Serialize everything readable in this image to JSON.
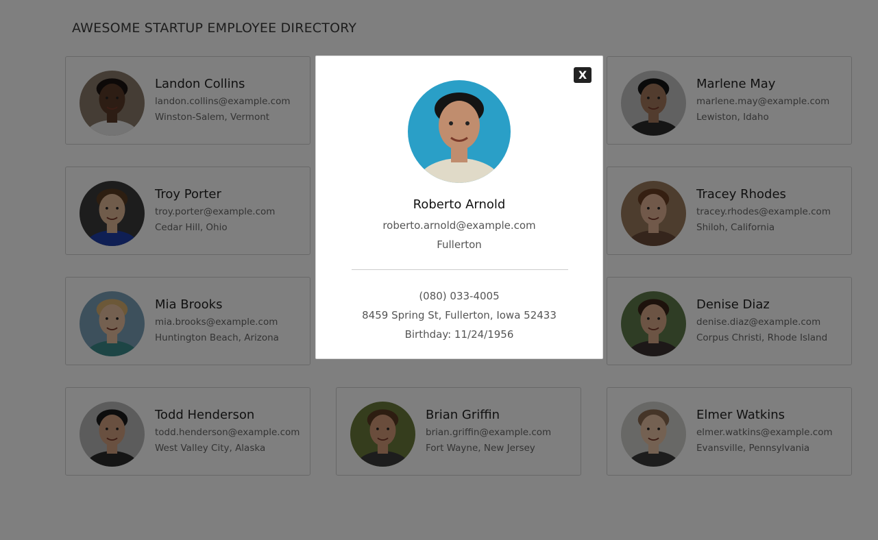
{
  "header": {
    "title": "AWESOME STARTUP EMPLOYEE DIRECTORY"
  },
  "employees": [
    {
      "name": "Landon Collins",
      "email": "landon.collins@example.com",
      "location": "Winston-Salem, Vermont",
      "skin": "#5a3a28",
      "bg": "#8a7a6a",
      "hair": "#1b1310",
      "shirt": "#e8e8e8"
    },
    {
      "name": "Roberto Arnold",
      "email": "roberto.arnold@example.com",
      "location": "Fullerton, Iowa",
      "skin": "#c08d6e",
      "bg": "#2a9fc7",
      "hair": "#141414",
      "shirt": "#e0dac8"
    },
    {
      "name": "Marlene May",
      "email": "marlene.may@example.com",
      "location": "Lewiston, Idaho",
      "skin": "#a4785c",
      "bg": "#c2c2c2",
      "hair": "#151515",
      "shirt": "#2b2b2b"
    },
    {
      "name": "Troy Porter",
      "email": "troy.porter@example.com",
      "location": "Cedar Hill, Ohio",
      "skin": "#e0b896",
      "bg": "#3a3a3a",
      "hair": "#5b3c22",
      "shirt": "#1f3fa8"
    },
    {
      "name": "Tracey Rhodes",
      "email": "tracey.rhodes@example.com",
      "location": "Shiloh, California",
      "skin": "#e2b295",
      "bg": "#9a7a5c",
      "hair": "#6a3e22",
      "shirt": "#6b4a38"
    },
    {
      "name": "Mia Brooks",
      "email": "mia.brooks@example.com",
      "location": "Huntington Beach, Arizona",
      "skin": "#e8c0a0",
      "bg": "#7ba0b8",
      "hair": "#d9b070",
      "shirt": "#3a8a8a"
    },
    {
      "name": "Denise Diaz",
      "email": "denise.diaz@example.com",
      "location": "Corpus Christi, Rhode Island",
      "skin": "#d8a888",
      "bg": "#5f7a4a",
      "hair": "#3a2418",
      "shirt": "#3a3030"
    },
    {
      "name": "Todd Henderson",
      "email": "todd.henderson@example.com",
      "location": "West Valley City, Alaska",
      "skin": "#d2a080",
      "bg": "#b8b8b8",
      "hair": "#1a1a1a",
      "shirt": "#2a2a2a"
    },
    {
      "name": "Brian Griffin",
      "email": "brian.griffin@example.com",
      "location": "Fort Wayne, New Jersey",
      "skin": "#d49a78",
      "bg": "#6a7a3a",
      "hair": "#5a3a22",
      "shirt": "#3a3a3a"
    },
    {
      "name": "Elmer Watkins",
      "email": "elmer.watkins@example.com",
      "location": "Evansville, Pennsylvania",
      "skin": "#e8c2a4",
      "bg": "#d0d0cc",
      "hair": "#8a6a50",
      "shirt": "#3a3a3a"
    }
  ],
  "modal": {
    "close_label": "X",
    "name": "Roberto Arnold",
    "email": "roberto.arnold@example.com",
    "city": "Fullerton",
    "phone": "(080) 033-4005",
    "address": "8459 Spring St, Fullerton, Iowa 52433",
    "birthday": "Birthday: 11/24/1956"
  }
}
